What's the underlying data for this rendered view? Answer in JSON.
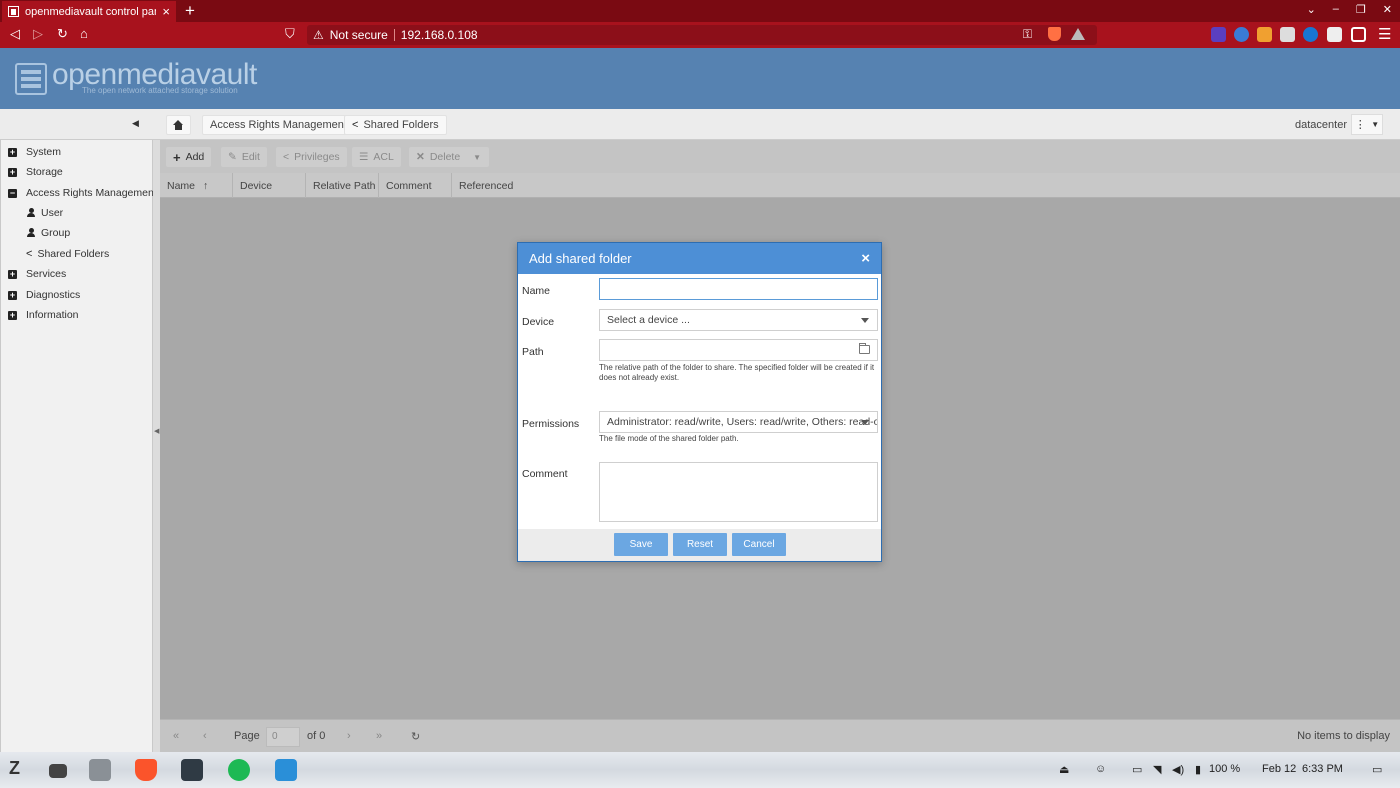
{
  "browser": {
    "tab_title": "openmediavault control pane",
    "security": "Not secure",
    "url": "192.168.0.108"
  },
  "header": {
    "logo": "openmediavault",
    "tagline": "The open network attached storage solution"
  },
  "breadcrumb": {
    "items": [
      "Access Rights Management",
      "Shared Folders"
    ],
    "server": "datacenter"
  },
  "sidebar": {
    "items": [
      {
        "label": "System",
        "expanded": false
      },
      {
        "label": "Storage",
        "expanded": false
      },
      {
        "label": "Access Rights Management",
        "expanded": true
      },
      {
        "label": "Services",
        "expanded": false
      },
      {
        "label": "Diagnostics",
        "expanded": false
      },
      {
        "label": "Information",
        "expanded": false
      }
    ],
    "subitems": [
      "User",
      "Group",
      "Shared Folders"
    ]
  },
  "toolbar": {
    "add": "Add",
    "edit": "Edit",
    "privileges": "Privileges",
    "acl": "ACL",
    "delete": "Delete"
  },
  "grid": {
    "columns": [
      "Name",
      "Device",
      "Relative Path",
      "Comment",
      "Referenced"
    ]
  },
  "pager": {
    "page_label": "Page",
    "page_value": "0",
    "of_label": "of 0",
    "status": "No items to display"
  },
  "dialog": {
    "title": "Add shared folder",
    "fields": {
      "name_label": "Name",
      "name_value": "",
      "device_label": "Device",
      "device_placeholder": "Select a device ...",
      "path_label": "Path",
      "path_value": "",
      "path_hint": "The relative path of the folder to share. The specified folder will be created if it does not already exist.",
      "permissions_label": "Permissions",
      "permissions_value": "Administrator: read/write, Users: read/write, Others: read-only",
      "permissions_hint": "The file mode of the shared folder path.",
      "comment_label": "Comment"
    },
    "buttons": {
      "save": "Save",
      "reset": "Reset",
      "cancel": "Cancel"
    }
  },
  "taskbar": {
    "battery": "100 %",
    "date": "Feb 12",
    "time": "6:33 PM"
  },
  "colors": {
    "browser_bar": "#a8121d",
    "omv_header": "#5682b1",
    "dialog_header": "#4d8fd6",
    "dialog_button": "#6ba7e2"
  }
}
